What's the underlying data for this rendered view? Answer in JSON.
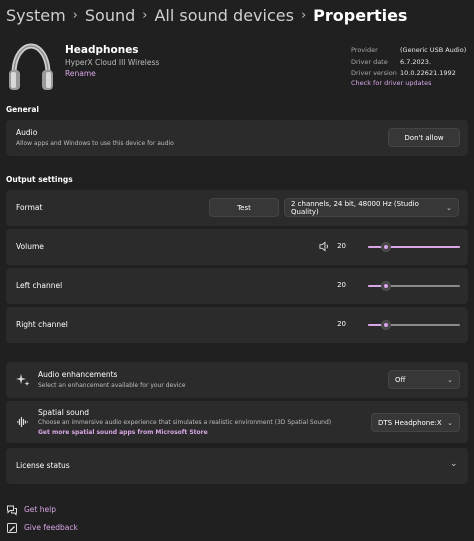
{
  "breadcrumb": [
    "System",
    "Sound",
    "All sound devices",
    "Properties"
  ],
  "device": {
    "name": "Headphones",
    "model": "HyperX Cloud III Wireless",
    "rename": "Rename",
    "info_labels": [
      "Provider",
      "Driver date",
      "Driver version"
    ],
    "info_values": [
      "(Generic USB Audio)",
      "6.7.2023.",
      "10.0.22621.1992"
    ],
    "driver_link": "Check for driver updates"
  },
  "general": {
    "title": "General",
    "audio_label": "Audio",
    "audio_desc": "Allow apps and Windows to use this device for audio",
    "dont_allow": "Don't allow"
  },
  "output": {
    "title": "Output settings",
    "format_label": "Format",
    "test_button": "Test",
    "format_value": "2 channels, 24 bit, 48000 Hz (Studio Quality)",
    "volume_label": "Volume",
    "volume_value": "20",
    "volume_fraction": 0.2,
    "left_label": "Left channel",
    "left_value": "20",
    "left_fraction": 0.2,
    "right_label": "Right channel",
    "right_value": "20",
    "right_fraction": 0.2
  },
  "enhancements": {
    "label": "Audio enhancements",
    "desc": "Select an enhancement available for your device",
    "value": "Off"
  },
  "spatial": {
    "label": "Spatial sound",
    "desc": "Choose an immersive audio experience that simulates a realistic environment (3D Spatial Sound)",
    "link": "Get more spatial sound apps from Microsoft Store",
    "value": "DTS Headphone:X"
  },
  "license": {
    "label": "License status"
  },
  "footer": {
    "help": "Get help",
    "feedback": "Give feedback"
  },
  "icons": {
    "device": "headphones-icon",
    "volume": "speaker-icon",
    "enhancements": "sparkle-icon",
    "spatial": "spatial-sound-icon",
    "help": "help-icon",
    "feedback": "feedback-icon"
  },
  "colors": {
    "accent": "#d8a6e6",
    "background": "#202020",
    "card": "#2b2b2b"
  }
}
